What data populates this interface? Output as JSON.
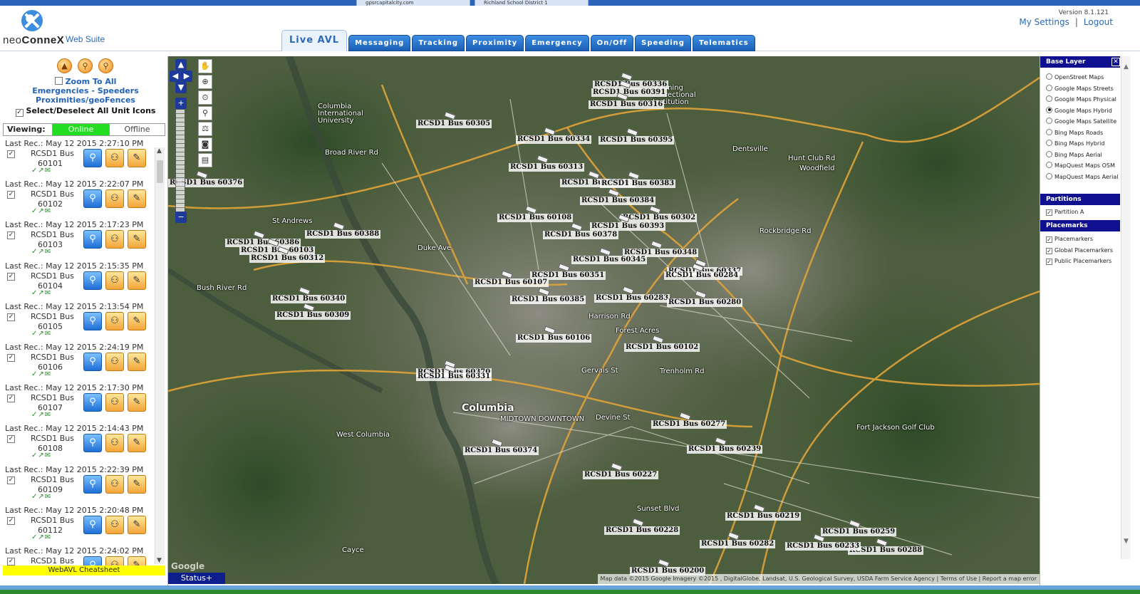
{
  "browser_tabs": [
    "gpsrcapitalcity.com",
    "Richland School District 1"
  ],
  "app": {
    "logo_word1": "neo",
    "logo_word2": "ConneX",
    "suite": "Web Suite",
    "version": "Version 8.1.121",
    "my_settings": "My Settings",
    "separator": "|",
    "logout": "Logout"
  },
  "tabs": [
    {
      "label": "Live AVL",
      "active": true
    },
    {
      "label": "Messaging"
    },
    {
      "label": "Tracking"
    },
    {
      "label": "Proximity"
    },
    {
      "label": "Emergency"
    },
    {
      "label": "On/Off"
    },
    {
      "label": "Speeding"
    },
    {
      "label": "Telematics"
    }
  ],
  "left_panel": {
    "zoom_to_all": "Zoom To All",
    "emergencies_line": "Emergencies - Speeders",
    "proximities_line": "Proximities/geoFences",
    "select_all": "Select/Deselect All Unit Icons",
    "viewing_label": "Viewing:",
    "online": "Online",
    "offline": "Offline",
    "cheatsheet": "WebAVL Cheatsheet",
    "units": [
      {
        "rec": "Last Rec.: May 12 2015 2:27:10 PM",
        "name1": "RCSD1 Bus",
        "name2": "60101"
      },
      {
        "rec": "Last Rec.: May 12 2015 2:22:07 PM",
        "name1": "RCSD1 Bus",
        "name2": "60102"
      },
      {
        "rec": "Last Rec.: May 12 2015 2:17:23 PM",
        "name1": "RCSD1 Bus",
        "name2": "60103"
      },
      {
        "rec": "Last Rec.: May 12 2015 2:15:35 PM",
        "name1": "RCSD1 Bus",
        "name2": "60104"
      },
      {
        "rec": "Last Rec.: May 12 2015 2:13:54 PM",
        "name1": "RCSD1 Bus",
        "name2": "60105"
      },
      {
        "rec": "Last Rec.: May 12 2015 2:24:19 PM",
        "name1": "RCSD1 Bus",
        "name2": "60106"
      },
      {
        "rec": "Last Rec.: May 12 2015 2:17:30 PM",
        "name1": "RCSD1 Bus",
        "name2": "60107"
      },
      {
        "rec": "Last Rec.: May 12 2015 2:14:43 PM",
        "name1": "RCSD1 Bus",
        "name2": "60108"
      },
      {
        "rec": "Last Rec.: May 12 2015 2:22:39 PM",
        "name1": "RCSD1 Bus",
        "name2": "60109"
      },
      {
        "rec": "Last Rec.: May 12 2015 2:20:48 PM",
        "name1": "RCSD1 Bus",
        "name2": "60112"
      },
      {
        "rec": "Last Rec.: May 12 2015 2:24:02 PM",
        "name1": "RCSD1 Bus",
        "name2": ""
      }
    ]
  },
  "map": {
    "places": [
      {
        "text": "Columbia International University"
      },
      {
        "text": "Manning Correctional Institution"
      },
      {
        "text": "Dentsville"
      },
      {
        "text": "Woodfield"
      },
      {
        "text": "St Andrews"
      },
      {
        "text": "Forest Acres"
      },
      {
        "text": "Columbia"
      },
      {
        "text": "MIDTOWN DOWNTOWN"
      },
      {
        "text": "West Columbia"
      },
      {
        "text": "Fort Jackson Golf Club"
      },
      {
        "text": "Cayce"
      },
      {
        "text": "Hunt Club Rd"
      },
      {
        "text": "Duke Ave"
      },
      {
        "text": "Harrison Rd"
      },
      {
        "text": "Trenholm Rd"
      },
      {
        "text": "Gervais St"
      },
      {
        "text": "Devine St"
      },
      {
        "text": "Rockbridge Rd"
      },
      {
        "text": "Broad River Rd"
      },
      {
        "text": "Bush River Rd"
      },
      {
        "text": "Sunset Blvd"
      }
    ],
    "buses": [
      "RCSD1 Bus 60336",
      "RCSD1 Bus 60391",
      "RCSD1 Bus 60316",
      "RCSD1 Bus 60305",
      "RCSD1 Bus 60334",
      "RCSD1 Bus 60395",
      "RCSD1 Bus 60313",
      "RCSD1 Bus 60376",
      "RCSD1 Bus 60303",
      "RCSD1 Bus 60383",
      "RCSD1 Bus 60384",
      "RCSD1 Bus 60108",
      "RCSD1 Bus 60302",
      "RCSD1 Bus 60393",
      "RCSD1 Bus 60388",
      "RCSD1 Bus 60378",
      "RCSD1 Bus 60386",
      "RCSD1 Bus 60103",
      "RCSD1 Bus 60312",
      "RCSD1 Bus 60348",
      "RCSD1 Bus 60345",
      "RCSD1 Bus 60337",
      "RCSD1 Bus 60284",
      "RCSD1 Bus 60351",
      "RCSD1 Bus 60107",
      "RCSD1 Bus 60340",
      "RCSD1 Bus 60385",
      "RCSD1 Bus 60283",
      "RCSD1 Bus 60280",
      "RCSD1 Bus 60309",
      "RCSD1 Bus 60106",
      "RCSD1 Bus 60102",
      "RCSD1 Bus 60370",
      "RCSD1 Bus 60331",
      "RCSD1 Bus 60277",
      "RCSD1 Bus 60239",
      "RCSD1 Bus 60374",
      "RCSD1 Bus 60227",
      "RCSD1 Bus 60288",
      "RCSD1 Bus 60219",
      "RCSD1 Bus 60228",
      "RCSD1 Bus 60259",
      "RCSD1 Bus 60282",
      "RCSD1 Bus 60233",
      "RCSD1 Bus 60200"
    ],
    "google": "Google",
    "attribution": "Map data ©2015 Google Imagery ©2015 , DigitalGlobe, Landsat, U.S. Geological Survey, USDA Farm Service Agency | Terms of Use | Report a map error",
    "status": "Status+"
  },
  "right_panel": {
    "base_layer": "Base Layer",
    "base_options": [
      {
        "label": "OpenStreet Maps",
        "on": false
      },
      {
        "label": "Google Maps Streets",
        "on": false
      },
      {
        "label": "Google Maps Physical",
        "on": false
      },
      {
        "label": "Google Maps Hybrid",
        "on": true
      },
      {
        "label": "Google Maps Satellite",
        "on": false
      },
      {
        "label": "Bing Maps Roads",
        "on": false
      },
      {
        "label": "Bing Maps Hybrid",
        "on": false
      },
      {
        "label": "Bing Maps Aerial",
        "on": false
      },
      {
        "label": "MapQuest Maps OSM",
        "on": false
      },
      {
        "label": "MapQuest Maps Aerial",
        "on": false
      }
    ],
    "partitions": "Partitions",
    "partition_a": "Partition A",
    "placemarks": "Placemarks",
    "placemark_options": [
      "Placemarkers",
      "Global Placemarkers",
      "Public Placemarkers"
    ]
  },
  "colors": {
    "tab_blue": "#1b5fb6",
    "online_green": "#22dd22",
    "panel_header_navy": "#0e1090",
    "cheatsheet_yellow": "#ffff00"
  }
}
